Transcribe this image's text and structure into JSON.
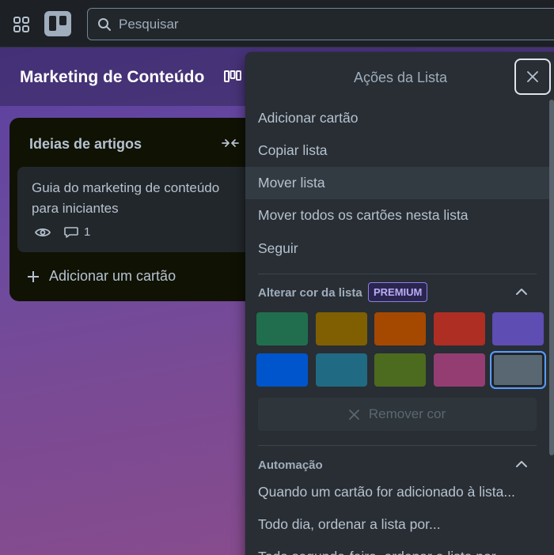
{
  "topbar": {
    "search_placeholder": "Pesquisar",
    "icons": [
      "apps-grid-icon",
      "trello-logo-icon",
      "search-icon"
    ]
  },
  "board": {
    "title": "Marketing de Conteúdo",
    "view_icon": "board-view-icon"
  },
  "list": {
    "title": "Ideias de artigos",
    "card": {
      "title": "Guia do marketing de conteúdo para iniciantes",
      "comment_count": "1"
    },
    "add_card_label": "Adicionar um cartão"
  },
  "popover": {
    "title": "Ações da Lista",
    "items": [
      {
        "label": "Adicionar cartão"
      },
      {
        "label": "Copiar lista"
      },
      {
        "label": "Mover lista"
      },
      {
        "label": "Mover todos os cartões nesta lista"
      },
      {
        "label": "Seguir"
      }
    ],
    "color_section": {
      "title": "Alterar cor da lista",
      "badge": "PREMIUM",
      "colors": [
        "#216e4e",
        "#7f5f01",
        "#a54800",
        "#ae2e24",
        "#5e4db2",
        "#0055cc",
        "#206a83",
        "#4c6b1f",
        "#943d73",
        "#596773"
      ],
      "selected_color": "#596773",
      "remove_label": "Remover cor"
    },
    "automation_section": {
      "title": "Automação",
      "items": [
        {
          "label": "Quando um cartão for adicionado à lista..."
        },
        {
          "label": "Todo dia, ordenar a lista por..."
        },
        {
          "label": "Toda segunda-feira, ordenar a lista por..."
        }
      ]
    }
  },
  "colors": {
    "accent": "#579dff",
    "premium": "#8f7ee7"
  }
}
